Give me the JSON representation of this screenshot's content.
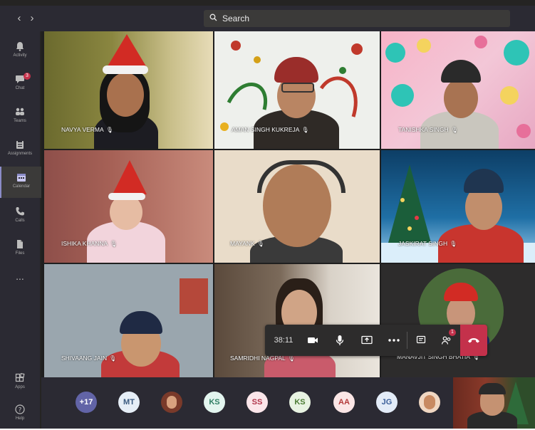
{
  "titlebar": {
    "back": "‹",
    "forward": "›",
    "search_placeholder": "Search"
  },
  "rail": [
    {
      "label": "Activity",
      "icon": "bell-icon"
    },
    {
      "label": "Chat",
      "icon": "chat-icon",
      "badge": "3"
    },
    {
      "label": "Teams",
      "icon": "teams-icon"
    },
    {
      "label": "Assignments",
      "icon": "assignments-icon"
    },
    {
      "label": "Calendar",
      "icon": "calendar-icon",
      "active": true
    },
    {
      "label": "Calls",
      "icon": "phone-icon"
    },
    {
      "label": "Files",
      "icon": "files-icon"
    },
    {
      "label": "...",
      "icon": "more-icon"
    },
    {
      "label": "Apps",
      "icon": "apps-icon"
    },
    {
      "label": "Help",
      "icon": "help-icon"
    }
  ],
  "participants": [
    {
      "name": "NAVYA VERMA"
    },
    {
      "name": "AMAN SINGH KUKREJA"
    },
    {
      "name": "TANISHKA SINGH"
    },
    {
      "name": "ISHIKA KHANNA"
    },
    {
      "name": "MAYANK"
    },
    {
      "name": "JASKIRAT SINGH"
    },
    {
      "name": "SHIVAANG JAIN"
    },
    {
      "name": "SAMRIDHI NAGPAL"
    },
    {
      "name": "MANAVJIT SINGH BHATIA"
    }
  ],
  "callbar": {
    "timer": "38:11",
    "participants_badge": "1"
  },
  "strip": {
    "avatars": [
      {
        "initials": "+17",
        "bg": "#6264a7",
        "fg": "#ffffff"
      },
      {
        "initials": "MT",
        "bg": "#e6eef7",
        "fg": "#3a5a80"
      },
      {
        "initials": "",
        "bg": "#7a3a2a",
        "fg": "#ffffff"
      },
      {
        "initials": "KS",
        "bg": "#e3f5ef",
        "fg": "#2f7f64"
      },
      {
        "initials": "SS",
        "bg": "#fbe6ea",
        "fg": "#b0344a"
      },
      {
        "initials": "KS",
        "bg": "#e8f3e2",
        "fg": "#4b7c33"
      },
      {
        "initials": "AA",
        "bg": "#fbe6e6",
        "fg": "#b33a3a"
      },
      {
        "initials": "JG",
        "bg": "#e3ecf8",
        "fg": "#3b5f9a"
      },
      {
        "initials": "",
        "bg": "#f0d7c2",
        "fg": "#ffffff"
      }
    ]
  },
  "colors": {
    "accent": "#6264a7",
    "hangup": "#c4314b",
    "chrome": "#2b2a33"
  }
}
